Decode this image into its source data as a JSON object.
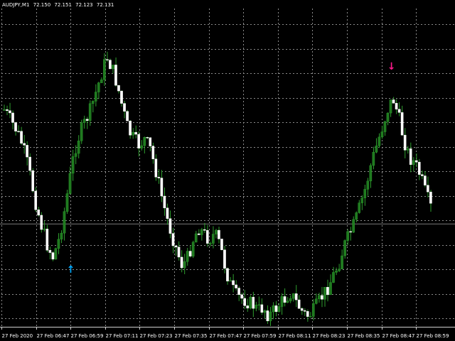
{
  "header": {
    "symbol_timeframe": "AUDJPY,M1",
    "open": "72.150",
    "high": "72.151",
    "low": "72.123",
    "close": "72.131"
  },
  "colors": {
    "background": "#000000",
    "grid": "#8a8a8a",
    "candle_up": "#1f7a1f",
    "candle_down": "#ffffff",
    "wick": "#2e9e2e",
    "bid_line": "#7a7a7a",
    "buy_arrow": "#00aaff",
    "sell_arrow": "#ff1a8c",
    "text": "#ffffff"
  },
  "chart_data": {
    "type": "candlestick",
    "title": "AUDJPY,M1",
    "x_tick_labels": [
      "27 Feb 2020",
      "27 Feb 06:47",
      "27 Feb 06:59",
      "27 Feb 07:11",
      "27 Feb 07:23",
      "27 Feb 07:35",
      "27 Feb 07:47",
      "27 Feb 07:59",
      "27 Feb 08:11",
      "27 Feb 08:23",
      "27 Feb 08:35",
      "27 Feb 08:47",
      "27 Feb 08:59"
    ],
    "grid": true,
    "grid_style": "dotted",
    "bid_line_level": 0.62,
    "trend_path": [
      0.3,
      0.33,
      0.36,
      0.4,
      0.46,
      0.54,
      0.63,
      0.7,
      0.76,
      0.8,
      0.75,
      0.66,
      0.55,
      0.44,
      0.38,
      0.34,
      0.3,
      0.24,
      0.18,
      0.12,
      0.16,
      0.22,
      0.3,
      0.37,
      0.4,
      0.42,
      0.4,
      0.43,
      0.5,
      0.58,
      0.66,
      0.72,
      0.78,
      0.83,
      0.8,
      0.74,
      0.7,
      0.72,
      0.74,
      0.72,
      0.76,
      0.84,
      0.9,
      0.93,
      0.94,
      0.95,
      0.96,
      0.98,
      0.97,
      1.0,
      0.98,
      0.96,
      0.94,
      0.92,
      0.95,
      0.98,
      1.0,
      0.99,
      0.96,
      0.93,
      0.9,
      0.86,
      0.82,
      0.76,
      0.72,
      0.68,
      0.62,
      0.56,
      0.48,
      0.42,
      0.36,
      0.3,
      0.26,
      0.32,
      0.4,
      0.46,
      0.48,
      0.52,
      0.58,
      0.63
    ],
    "signals": [
      {
        "type": "buy",
        "bar_fraction": 0.158,
        "glyph": "↑"
      },
      {
        "type": "sell",
        "bar_fraction": 0.905,
        "glyph": "↓"
      }
    ]
  }
}
